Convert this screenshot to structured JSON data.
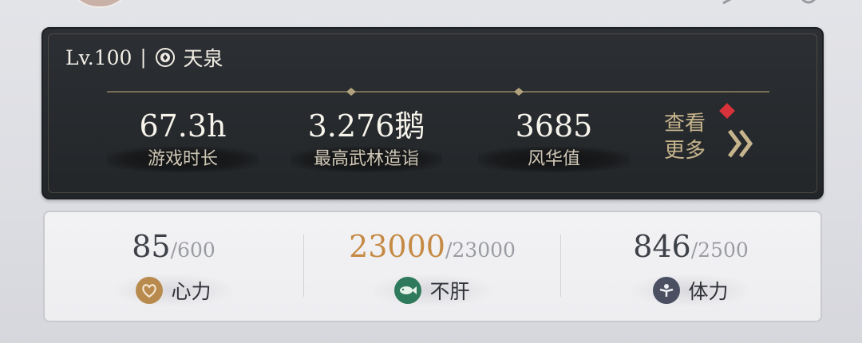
{
  "header": {
    "level": "Lv.100",
    "separator": "|",
    "server": "天泉"
  },
  "stats": [
    {
      "value": "67.3h",
      "label": "游戏时长"
    },
    {
      "value": "3.276鹅",
      "label": "最高武林造诣"
    },
    {
      "value": "3685",
      "label": "风华值"
    }
  ],
  "more": {
    "line1": "查看",
    "line2": "更多"
  },
  "resources": [
    {
      "current": "85",
      "max": "/600",
      "label": "心力",
      "icon": "heart-spirit-icon",
      "color": "#b98a4e"
    },
    {
      "current": "23000",
      "max": "/23000",
      "label": "不肝",
      "icon": "fish-icon",
      "color": "#2f7a5c"
    },
    {
      "current": "846",
      "max": "/2500",
      "label": "体力",
      "icon": "stamina-icon",
      "color": "#4a5062"
    }
  ],
  "colors": {
    "gold_value": "#c58a44",
    "panel_dark": "#2c2f33",
    "accent_red": "#d8323a"
  }
}
